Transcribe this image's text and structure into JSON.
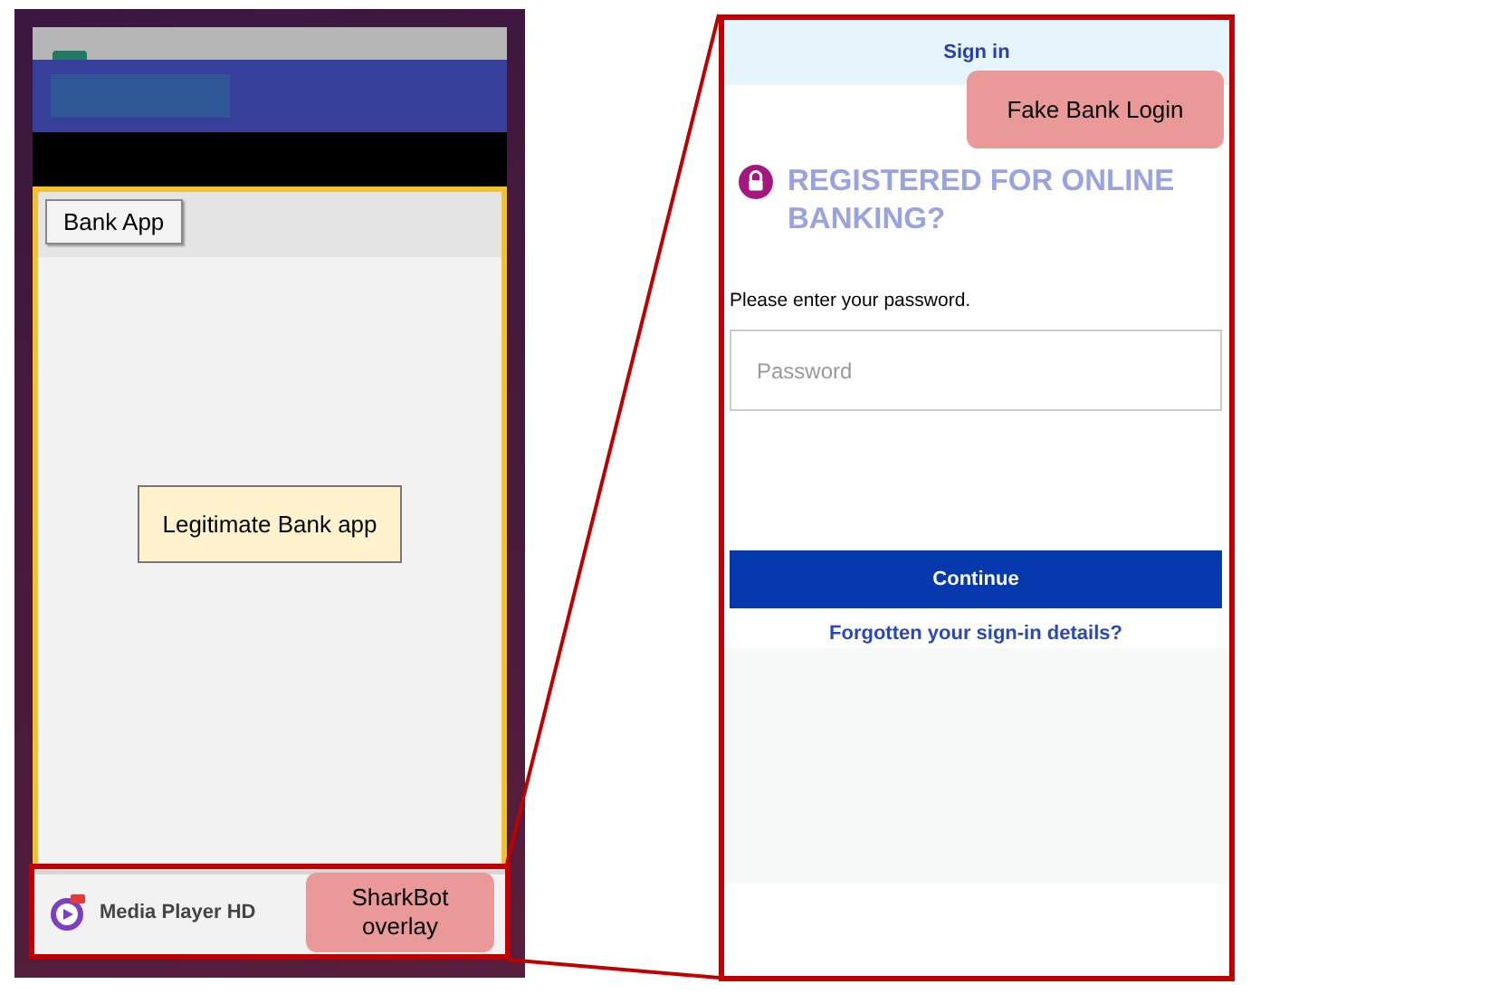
{
  "bank_app": {
    "tab_label": "Bank App",
    "center_label": "Legitimate Bank app"
  },
  "overlay": {
    "app_name": "Media Player HD",
    "annotation": "SharkBot overlay"
  },
  "fake_login": {
    "header": "Sign in",
    "annotation": "Fake Bank Login",
    "heading": "REGISTERED FOR ONLINE BANKING?",
    "prompt": "Please enter your password.",
    "password": {
      "placeholder": "Password"
    },
    "button": "Continue",
    "link": "Forgotten your sign-in details?"
  }
}
